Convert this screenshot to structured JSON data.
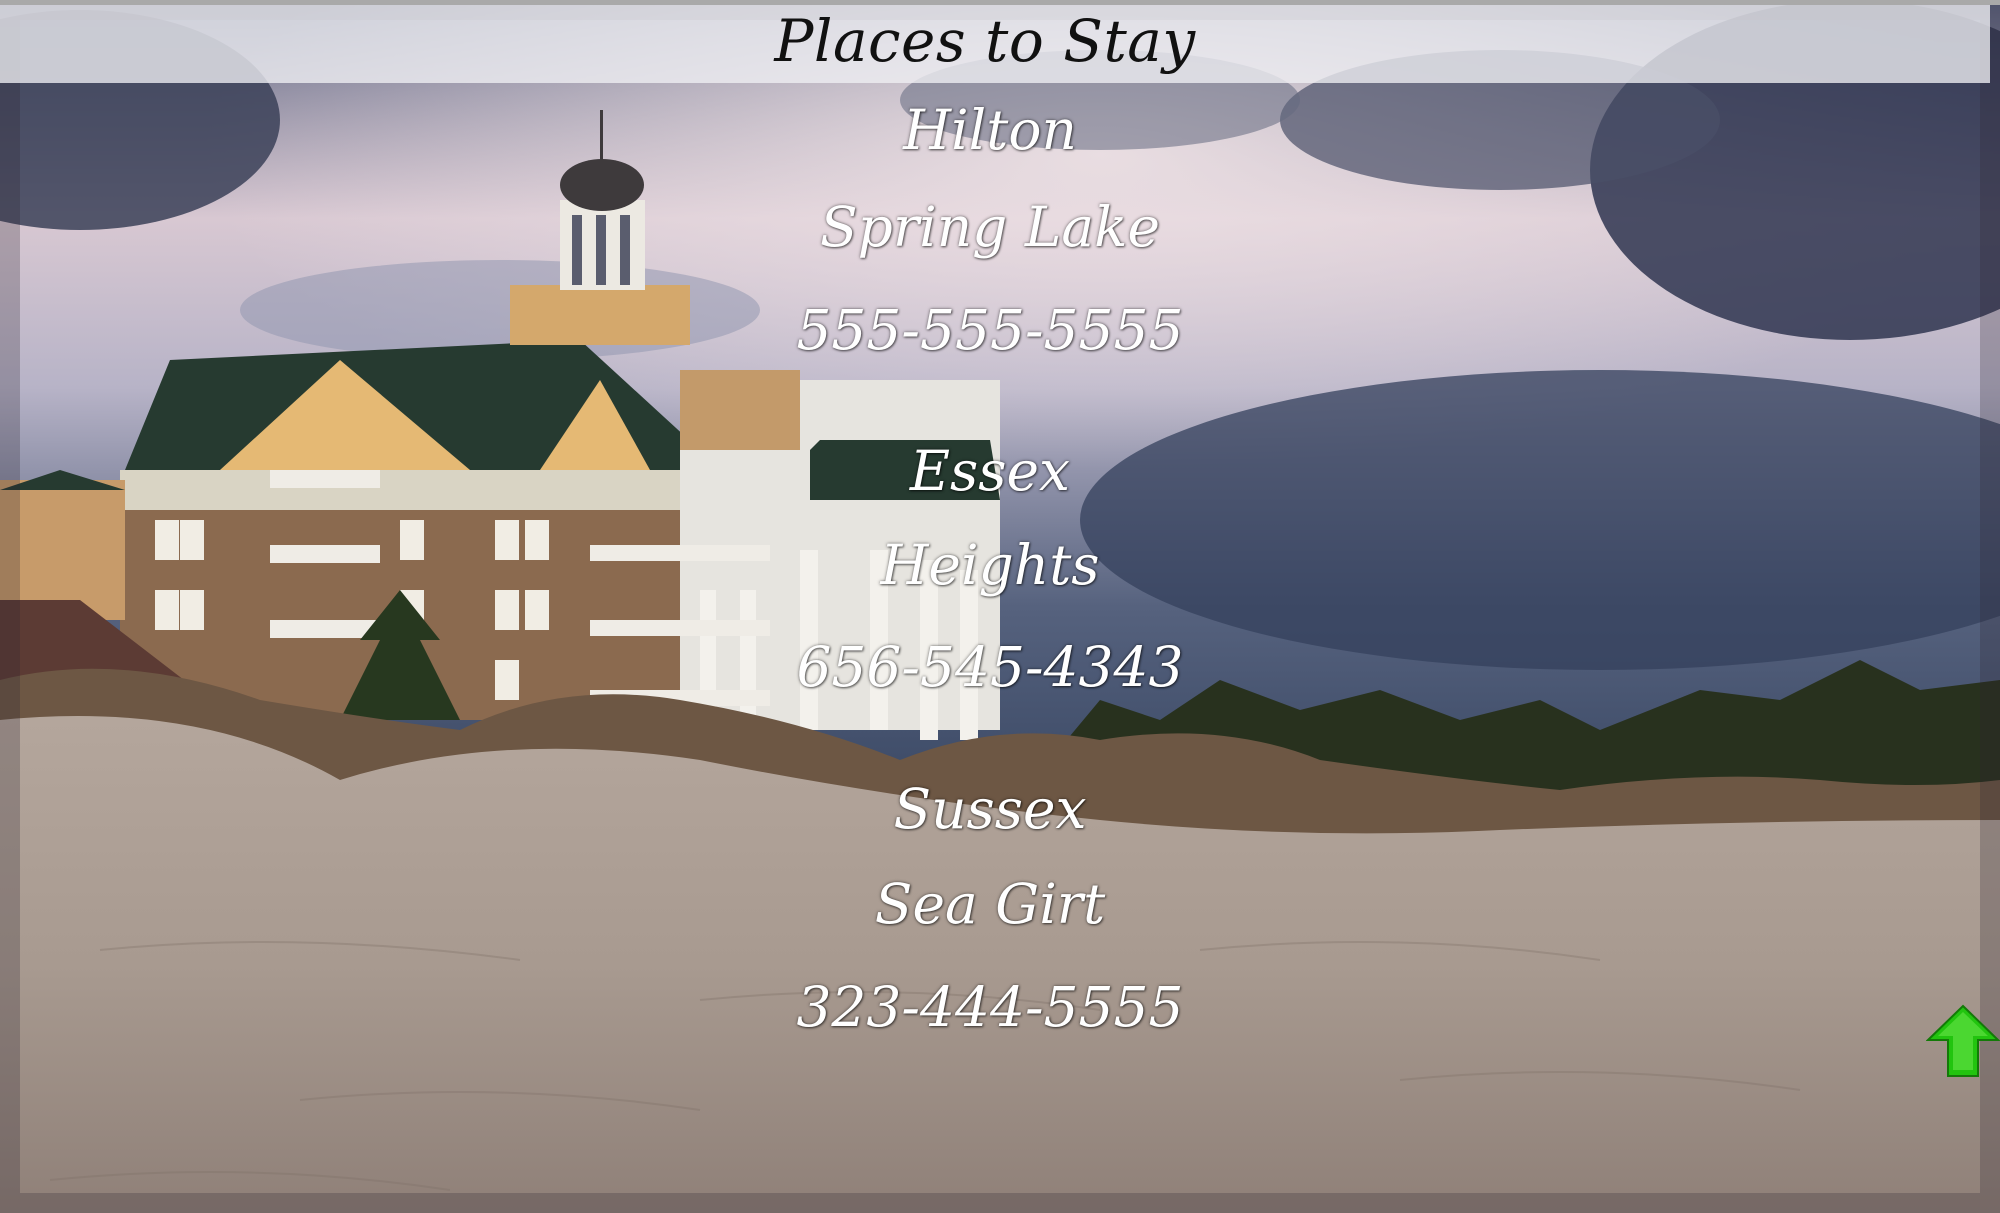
{
  "page": {
    "title": "Places to Stay"
  },
  "listings": [
    {
      "name": "Hilton",
      "location": "Spring Lake",
      "phone": "555-555-5555"
    },
    {
      "name": "Essex",
      "location": "Heights",
      "phone": "656-545-4343"
    },
    {
      "name": "Sussex",
      "location": "Sea Girt",
      "phone": "323-444-5555"
    }
  ],
  "controls": {
    "back_to_top_icon": "up-arrow-icon",
    "back_to_top_color": "#22c40f"
  },
  "background": {
    "subject": "beach-hotel-photo"
  }
}
